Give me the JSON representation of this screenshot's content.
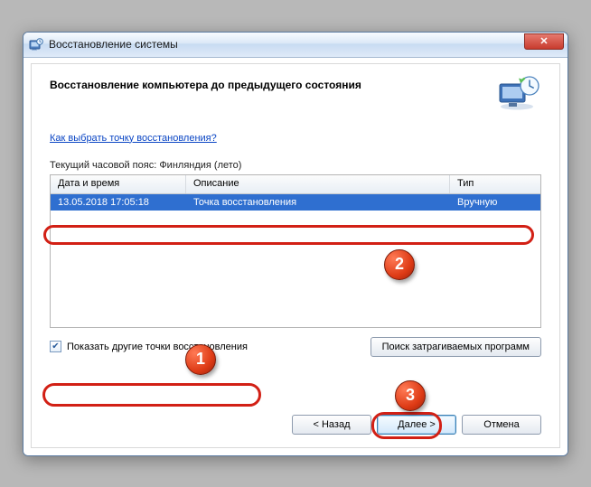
{
  "window": {
    "title": "Восстановление системы"
  },
  "page": {
    "heading": "Восстановление компьютера до предыдущего состояния",
    "help_link": "Как выбрать точку восстановления?",
    "timezone_label": "Текущий часовой пояс: Финляндия (лето)"
  },
  "table": {
    "headers": {
      "datetime": "Дата и время",
      "description": "Описание",
      "type": "Тип"
    },
    "rows": [
      {
        "datetime": "13.05.2018 17:05:18",
        "description": "Точка восстановления",
        "type": "Вручную"
      }
    ]
  },
  "controls": {
    "show_other_label": "Показать другие точки восстановления",
    "show_other_checked": true,
    "scan_affected": "Поиск затрагиваемых программ"
  },
  "buttons": {
    "back": "< Назад",
    "next": "Далее >",
    "cancel": "Отмена"
  },
  "callouts": {
    "one": "1",
    "two": "2",
    "three": "3"
  }
}
